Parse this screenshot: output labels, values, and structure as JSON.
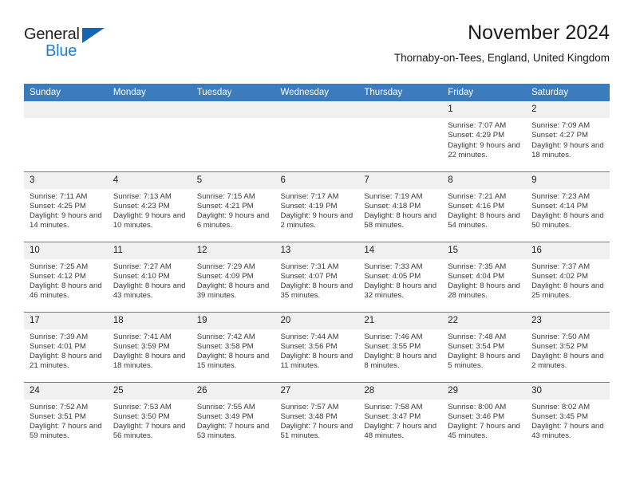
{
  "brand": {
    "line1": "General",
    "line2": "Blue",
    "triangle_icon": "triangle-icon",
    "accent_dark": "#1565b0",
    "accent_light": "#1f7fd4"
  },
  "header": {
    "title": "November 2024",
    "location": "Thornaby-on-Tees, England, United Kingdom"
  },
  "theme": {
    "header_bg": "#3b7cbe",
    "daynum_bg": "#f0f0f0",
    "row_border": "#4a88c4"
  },
  "columns": [
    "Sunday",
    "Monday",
    "Tuesday",
    "Wednesday",
    "Thursday",
    "Friday",
    "Saturday"
  ],
  "weeks": [
    [
      {
        "day": "",
        "empty": true
      },
      {
        "day": "",
        "empty": true
      },
      {
        "day": "",
        "empty": true
      },
      {
        "day": "",
        "empty": true
      },
      {
        "day": "",
        "empty": true
      },
      {
        "day": "1",
        "sunrise": "Sunrise: 7:07 AM",
        "sunset": "Sunset: 4:29 PM",
        "daylight": "Daylight: 9 hours and 22 minutes."
      },
      {
        "day": "2",
        "sunrise": "Sunrise: 7:09 AM",
        "sunset": "Sunset: 4:27 PM",
        "daylight": "Daylight: 9 hours and 18 minutes."
      }
    ],
    [
      {
        "day": "3",
        "sunrise": "Sunrise: 7:11 AM",
        "sunset": "Sunset: 4:25 PM",
        "daylight": "Daylight: 9 hours and 14 minutes."
      },
      {
        "day": "4",
        "sunrise": "Sunrise: 7:13 AM",
        "sunset": "Sunset: 4:23 PM",
        "daylight": "Daylight: 9 hours and 10 minutes."
      },
      {
        "day": "5",
        "sunrise": "Sunrise: 7:15 AM",
        "sunset": "Sunset: 4:21 PM",
        "daylight": "Daylight: 9 hours and 6 minutes."
      },
      {
        "day": "6",
        "sunrise": "Sunrise: 7:17 AM",
        "sunset": "Sunset: 4:19 PM",
        "daylight": "Daylight: 9 hours and 2 minutes."
      },
      {
        "day": "7",
        "sunrise": "Sunrise: 7:19 AM",
        "sunset": "Sunset: 4:18 PM",
        "daylight": "Daylight: 8 hours and 58 minutes."
      },
      {
        "day": "8",
        "sunrise": "Sunrise: 7:21 AM",
        "sunset": "Sunset: 4:16 PM",
        "daylight": "Daylight: 8 hours and 54 minutes."
      },
      {
        "day": "9",
        "sunrise": "Sunrise: 7:23 AM",
        "sunset": "Sunset: 4:14 PM",
        "daylight": "Daylight: 8 hours and 50 minutes."
      }
    ],
    [
      {
        "day": "10",
        "sunrise": "Sunrise: 7:25 AM",
        "sunset": "Sunset: 4:12 PM",
        "daylight": "Daylight: 8 hours and 46 minutes."
      },
      {
        "day": "11",
        "sunrise": "Sunrise: 7:27 AM",
        "sunset": "Sunset: 4:10 PM",
        "daylight": "Daylight: 8 hours and 43 minutes."
      },
      {
        "day": "12",
        "sunrise": "Sunrise: 7:29 AM",
        "sunset": "Sunset: 4:09 PM",
        "daylight": "Daylight: 8 hours and 39 minutes."
      },
      {
        "day": "13",
        "sunrise": "Sunrise: 7:31 AM",
        "sunset": "Sunset: 4:07 PM",
        "daylight": "Daylight: 8 hours and 35 minutes."
      },
      {
        "day": "14",
        "sunrise": "Sunrise: 7:33 AM",
        "sunset": "Sunset: 4:05 PM",
        "daylight": "Daylight: 8 hours and 32 minutes."
      },
      {
        "day": "15",
        "sunrise": "Sunrise: 7:35 AM",
        "sunset": "Sunset: 4:04 PM",
        "daylight": "Daylight: 8 hours and 28 minutes."
      },
      {
        "day": "16",
        "sunrise": "Sunrise: 7:37 AM",
        "sunset": "Sunset: 4:02 PM",
        "daylight": "Daylight: 8 hours and 25 minutes."
      }
    ],
    [
      {
        "day": "17",
        "sunrise": "Sunrise: 7:39 AM",
        "sunset": "Sunset: 4:01 PM",
        "daylight": "Daylight: 8 hours and 21 minutes."
      },
      {
        "day": "18",
        "sunrise": "Sunrise: 7:41 AM",
        "sunset": "Sunset: 3:59 PM",
        "daylight": "Daylight: 8 hours and 18 minutes."
      },
      {
        "day": "19",
        "sunrise": "Sunrise: 7:42 AM",
        "sunset": "Sunset: 3:58 PM",
        "daylight": "Daylight: 8 hours and 15 minutes."
      },
      {
        "day": "20",
        "sunrise": "Sunrise: 7:44 AM",
        "sunset": "Sunset: 3:56 PM",
        "daylight": "Daylight: 8 hours and 11 minutes."
      },
      {
        "day": "21",
        "sunrise": "Sunrise: 7:46 AM",
        "sunset": "Sunset: 3:55 PM",
        "daylight": "Daylight: 8 hours and 8 minutes."
      },
      {
        "day": "22",
        "sunrise": "Sunrise: 7:48 AM",
        "sunset": "Sunset: 3:54 PM",
        "daylight": "Daylight: 8 hours and 5 minutes."
      },
      {
        "day": "23",
        "sunrise": "Sunrise: 7:50 AM",
        "sunset": "Sunset: 3:52 PM",
        "daylight": "Daylight: 8 hours and 2 minutes."
      }
    ],
    [
      {
        "day": "24",
        "sunrise": "Sunrise: 7:52 AM",
        "sunset": "Sunset: 3:51 PM",
        "daylight": "Daylight: 7 hours and 59 minutes."
      },
      {
        "day": "25",
        "sunrise": "Sunrise: 7:53 AM",
        "sunset": "Sunset: 3:50 PM",
        "daylight": "Daylight: 7 hours and 56 minutes."
      },
      {
        "day": "26",
        "sunrise": "Sunrise: 7:55 AM",
        "sunset": "Sunset: 3:49 PM",
        "daylight": "Daylight: 7 hours and 53 minutes."
      },
      {
        "day": "27",
        "sunrise": "Sunrise: 7:57 AM",
        "sunset": "Sunset: 3:48 PM",
        "daylight": "Daylight: 7 hours and 51 minutes."
      },
      {
        "day": "28",
        "sunrise": "Sunrise: 7:58 AM",
        "sunset": "Sunset: 3:47 PM",
        "daylight": "Daylight: 7 hours and 48 minutes."
      },
      {
        "day": "29",
        "sunrise": "Sunrise: 8:00 AM",
        "sunset": "Sunset: 3:46 PM",
        "daylight": "Daylight: 7 hours and 45 minutes."
      },
      {
        "day": "30",
        "sunrise": "Sunrise: 8:02 AM",
        "sunset": "Sunset: 3:45 PM",
        "daylight": "Daylight: 7 hours and 43 minutes."
      }
    ]
  ]
}
